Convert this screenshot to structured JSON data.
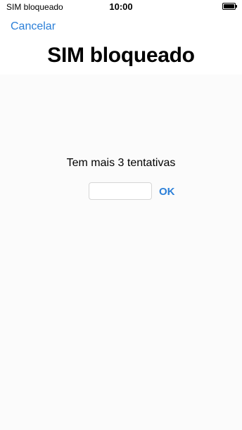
{
  "status_bar": {
    "carrier": "SIM bloqueado",
    "time": "10:00",
    "battery_icon": "battery-full-icon"
  },
  "nav": {
    "cancel_label": "Cancelar"
  },
  "page": {
    "title": "SIM bloqueado",
    "attempts_text": "Tem mais 3 tentativas"
  },
  "pin": {
    "value": "",
    "placeholder": ""
  },
  "actions": {
    "ok_label": "OK"
  },
  "colors": {
    "accent": "#2b7fd8",
    "background": "#fbfbfb"
  }
}
